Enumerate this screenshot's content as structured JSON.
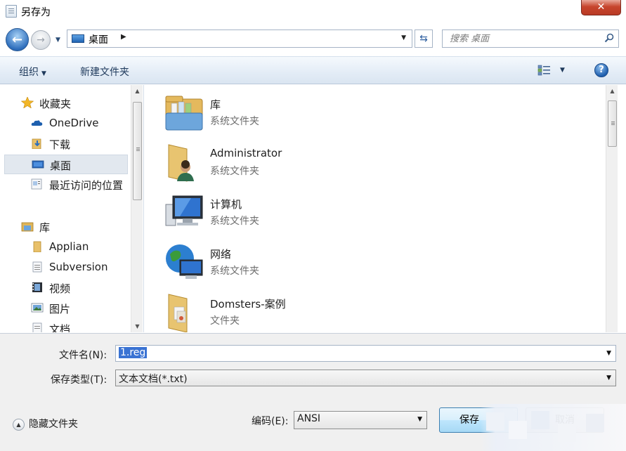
{
  "window": {
    "title": "另存为",
    "close_glyph": "✕"
  },
  "address_bar": {
    "path_label": "桌面",
    "search_placeholder": "搜索 桌面"
  },
  "toolbar": {
    "organize_label": "组织",
    "new_folder_label": "新建文件夹"
  },
  "nav_pane": {
    "favorites": [
      {
        "label": "收藏夹",
        "icon": "star-icon"
      },
      {
        "label": "OneDrive",
        "icon": "onedrive-cloud-icon"
      },
      {
        "label": "下载",
        "icon": "downloads-folder-icon"
      },
      {
        "label": "桌面",
        "icon": "desktop-icon",
        "selected": true
      },
      {
        "label": "最近访问的位置",
        "icon": "recent-places-icon"
      }
    ],
    "libraries": [
      {
        "label": "库",
        "icon": "library-icon"
      },
      {
        "label": "Applian",
        "icon": "folder-icon"
      },
      {
        "label": "Subversion",
        "icon": "document-icon"
      },
      {
        "label": "视频",
        "icon": "video-icon"
      },
      {
        "label": "图片",
        "icon": "pictures-icon"
      },
      {
        "label": "文档",
        "icon": "documents-icon"
      }
    ]
  },
  "file_list": [
    {
      "name": "库",
      "type": "系统文件夹",
      "icon": "library-large-icon"
    },
    {
      "name": "Administrator",
      "type": "系统文件夹",
      "icon": "user-folder-icon"
    },
    {
      "name": "计算机",
      "type": "系统文件夹",
      "icon": "computer-icon"
    },
    {
      "name": "网络",
      "type": "系统文件夹",
      "icon": "network-globe-icon"
    },
    {
      "name": "Domsters-案例",
      "type": "文件夹",
      "icon": "folder-large-icon"
    }
  ],
  "form": {
    "filename_label": "文件名(N):",
    "filename_value": "1.reg",
    "filetype_label": "保存类型(T):",
    "filetype_value": "文本文档(*.txt)",
    "encoding_label": "编码(E):",
    "encoding_value": "ANSI",
    "hide_folders_label": "隐藏文件夹",
    "save_label": "保存",
    "cancel_label": "取消"
  },
  "colors": {
    "toolbar_bg": "#e3ecf6",
    "selection_bg": "#3a73d3",
    "save_button_bg": "#bee6fd",
    "close_button_bg": "#c7452d"
  }
}
